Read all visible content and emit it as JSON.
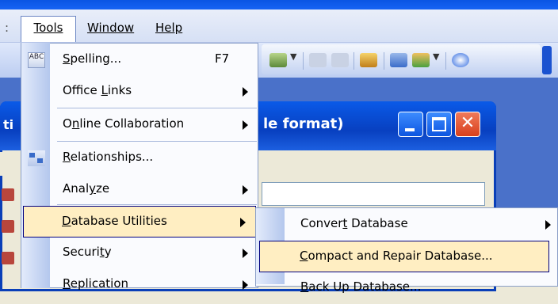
{
  "menubar": {
    "tools": "Tools",
    "window": "Window",
    "help": "Help"
  },
  "dialog": {
    "title_left": "ti",
    "title_right": "le format)"
  },
  "tools_menu": [
    {
      "label_pre": "",
      "label_u": "S",
      "label_post": "pelling...",
      "shortcut": "F7",
      "icon": "spelling-icon"
    },
    {
      "label_pre": "Office ",
      "label_u": "L",
      "label_post": "inks",
      "submenu": true
    },
    {
      "label_pre": "O",
      "label_u": "n",
      "label_post": "line Collaboration",
      "submenu": true
    },
    {
      "label_pre": "",
      "label_u": "R",
      "label_post": "elationships...",
      "icon": "relationships-icon"
    },
    {
      "label_pre": "Anal",
      "label_u": "y",
      "label_post": "ze",
      "submenu": true
    },
    {
      "label_pre": "",
      "label_u": "D",
      "label_post": "atabase Utilities",
      "submenu": true
    },
    {
      "label_pre": "Securi",
      "label_u": "t",
      "label_post": "y",
      "submenu": true
    },
    {
      "label_pre": "",
      "label_u": "R",
      "label_post": "eplication",
      "submenu": true
    }
  ],
  "submenu": [
    {
      "label_pre": "Conver",
      "label_u": "t",
      "label_post": " Database",
      "submenu": true
    },
    {
      "label_pre": "",
      "label_u": "C",
      "label_post": "ompact and Repair Database..."
    },
    {
      "label_pre": "",
      "label_u": "B",
      "label_post": "ack Up Database..."
    }
  ],
  "colors": {
    "highlight": "#ffeec2",
    "highlight_border": "#000080",
    "title_blue": "#0a4fd6"
  }
}
